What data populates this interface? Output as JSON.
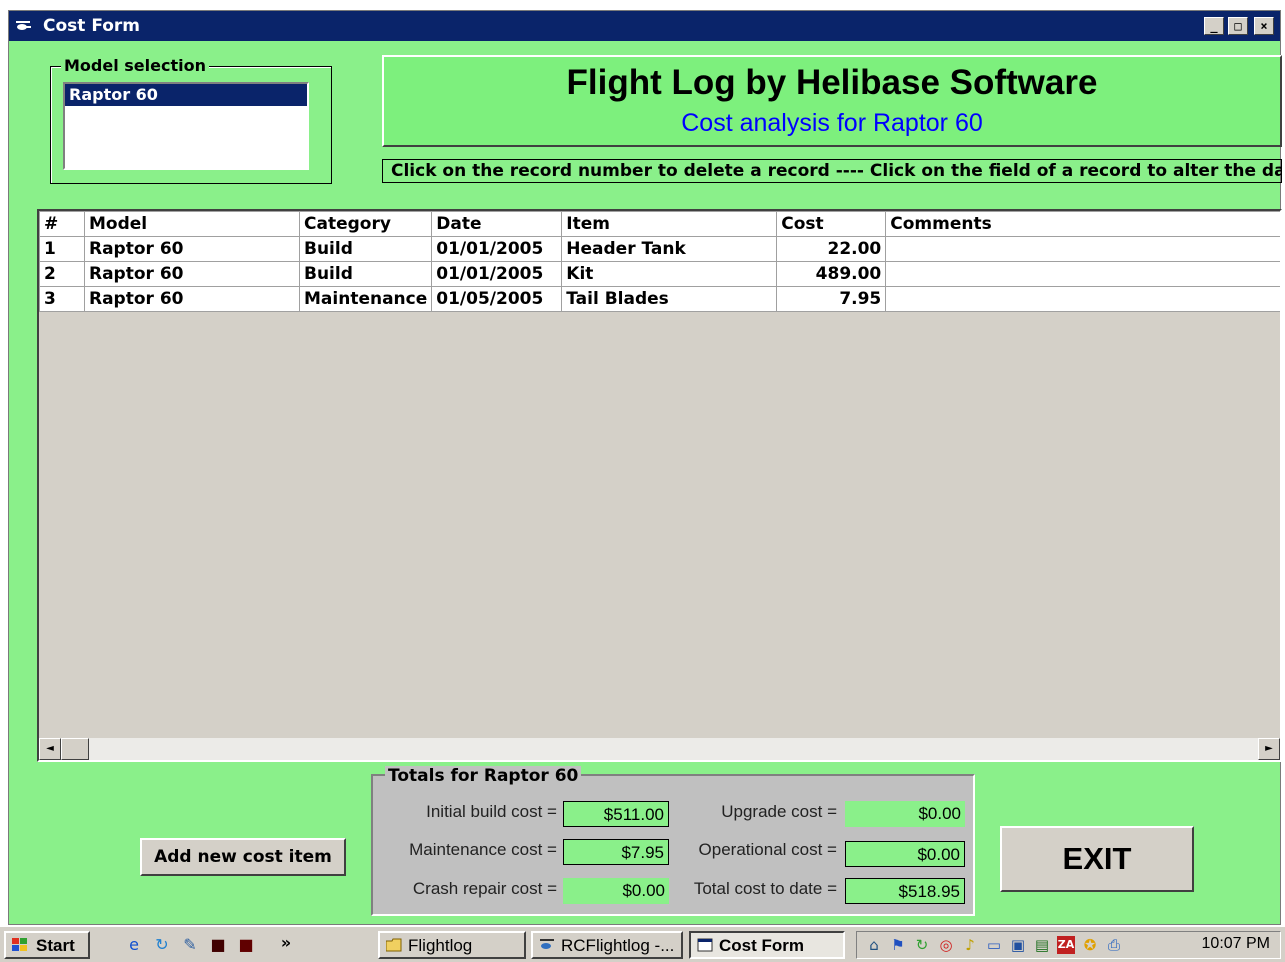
{
  "window": {
    "title": "Cost Form",
    "controls": {
      "minimize": "_",
      "maximize": "□",
      "close": "×"
    }
  },
  "model_selection": {
    "legend": "Model selection",
    "items": [
      "Raptor 60"
    ],
    "selected": "Raptor 60"
  },
  "header": {
    "title": "Flight Log by Helibase Software",
    "subtitle": "Cost analysis for Raptor 60",
    "hint": "Click on the record number to delete a record ---- Click on the field of a record to alter the data."
  },
  "grid": {
    "columns": [
      "#",
      "Model",
      "Category",
      "Date",
      "Item",
      "Cost",
      "Comments"
    ],
    "rows": [
      {
        "num": "1",
        "model": "Raptor 60",
        "category": "Build",
        "date": "01/01/2005",
        "item": "Header Tank",
        "cost": "22.00",
        "comments": ""
      },
      {
        "num": "2",
        "model": "Raptor 60",
        "category": "Build",
        "date": "01/01/2005",
        "item": "Kit",
        "cost": "489.00",
        "comments": ""
      },
      {
        "num": "3",
        "model": "Raptor 60",
        "category": "Maintenance",
        "date": "01/05/2005",
        "item": "Tail Blades",
        "cost": "7.95",
        "comments": ""
      }
    ],
    "scroll_left": "◄",
    "scroll_right": "►"
  },
  "totals": {
    "legend": "Totals for Raptor 60",
    "initial_build_label": "Initial build cost =",
    "initial_build_value": "$511.00",
    "maintenance_label": "Maintenance cost =",
    "maintenance_value": "$7.95",
    "crash_repair_label": "Crash repair cost =",
    "crash_repair_value": "$0.00",
    "upgrade_label": "Upgrade cost =",
    "upgrade_value": "$0.00",
    "operational_label": "Operational cost =",
    "operational_value": "$0.00",
    "total_label": "Total cost to date =",
    "total_value": "$518.95"
  },
  "buttons": {
    "add_new": "Add new cost item",
    "exit": "EXIT"
  },
  "taskbar": {
    "start": "Start",
    "chevron": "»",
    "items": [
      "Flightlog",
      "RCFlightlog -...",
      "Cost Form"
    ],
    "clock": "10:07 PM"
  },
  "colors": {
    "form_background": "#8af08a",
    "header_panel": "#7df07d",
    "titlebar": "#0a246a",
    "subtitle": "#0000ff"
  }
}
